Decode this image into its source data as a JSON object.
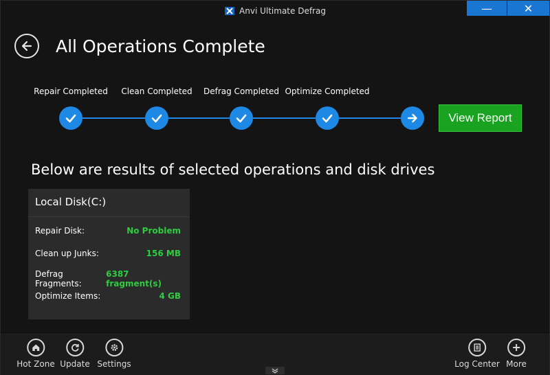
{
  "window": {
    "title": "Anvi Ultimate Defrag",
    "minimize_glyph": "—",
    "close_glyph": "✕"
  },
  "header": {
    "title": "All Operations Complete"
  },
  "steps": [
    {
      "label": "Repair Completed",
      "icon": "check-icon"
    },
    {
      "label": "Clean Completed",
      "icon": "check-icon"
    },
    {
      "label": "Defrag Completed",
      "icon": "check-icon"
    },
    {
      "label": "Optimize Completed",
      "icon": "check-icon"
    },
    {
      "label": "",
      "icon": "arrow-right-icon"
    }
  ],
  "view_report_label": "View Report",
  "results_heading": "Below are results of selected operations and disk drives",
  "disk": {
    "name": "Local Disk(C:)",
    "rows": [
      {
        "label": "Repair Disk:",
        "value": "No Problem"
      },
      {
        "label": "Clean up Junks:",
        "value": "156 MB"
      },
      {
        "label": "Defrag Fragments:",
        "value": "6387 fragment(s)"
      },
      {
        "label": "Optimize Items:",
        "value": "4 GB"
      }
    ]
  },
  "bottom_nav": {
    "left": [
      {
        "label": "Hot Zone",
        "icon": "home-icon"
      },
      {
        "label": "Update",
        "icon": "refresh-icon"
      },
      {
        "label": "Settings",
        "icon": "gear-icon"
      }
    ],
    "right": [
      {
        "label": "Log Center",
        "icon": "list-icon"
      },
      {
        "label": "More",
        "icon": "plus-icon"
      }
    ]
  },
  "colors": {
    "accent_blue": "#1e88e5",
    "success_green": "#2ecc40",
    "button_green": "#1aa221",
    "background": "#141414"
  }
}
